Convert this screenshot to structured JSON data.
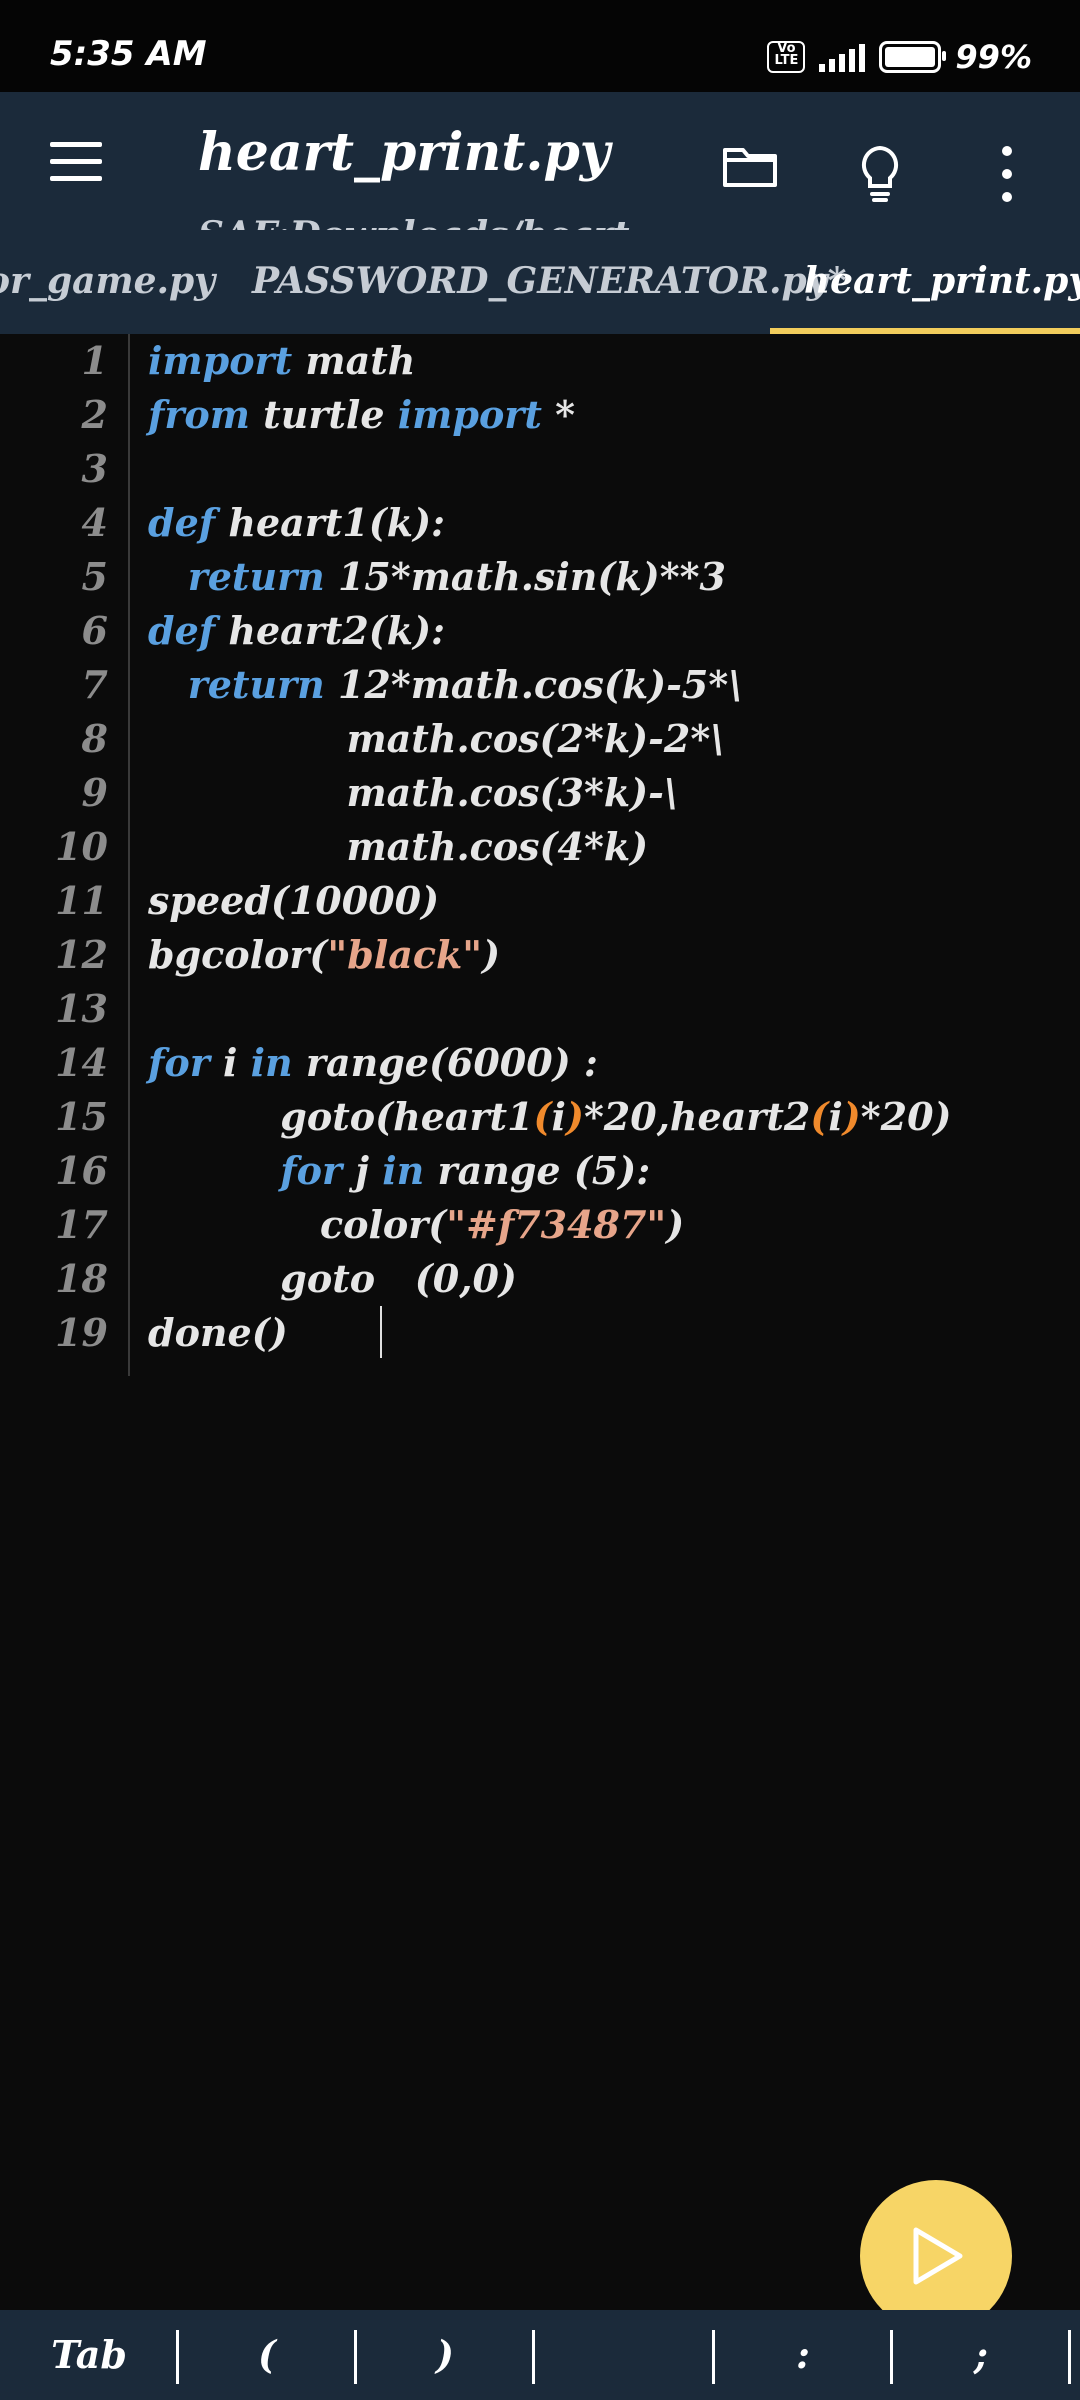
{
  "status_bar": {
    "time": "5:35 AM",
    "volte_label": "Vo LTE",
    "battery_percent": "99%",
    "battery_level": 0.99
  },
  "toolbar": {
    "title": "heart_print.py",
    "subtitle": "SAF:Downloads/heart"
  },
  "tabs": [
    {
      "label": "or_game.py"
    },
    {
      "label": "PASSWORD_GENERATOR.py*"
    },
    {
      "label": "heart_print.py"
    }
  ],
  "editor": {
    "lines": [
      {
        "n": "1",
        "segments": [
          {
            "t": "import",
            "c": "kw"
          },
          {
            "t": " math",
            "c": ""
          }
        ]
      },
      {
        "n": "2",
        "segments": [
          {
            "t": "from",
            "c": "kw"
          },
          {
            "t": " turtle ",
            "c": ""
          },
          {
            "t": "import",
            "c": "kw"
          },
          {
            "t": " *",
            "c": ""
          }
        ]
      },
      {
        "n": "3",
        "segments": []
      },
      {
        "n": "4",
        "segments": [
          {
            "t": "def",
            "c": "kw"
          },
          {
            "t": " heart1(k):",
            "c": ""
          }
        ]
      },
      {
        "n": "5",
        "segments": [
          {
            "t": "   ",
            "c": ""
          },
          {
            "t": "return",
            "c": "kw"
          },
          {
            "t": " 15*math.sin(k)**3",
            "c": ""
          }
        ]
      },
      {
        "n": "6",
        "segments": [
          {
            "t": "def",
            "c": "kw"
          },
          {
            "t": " heart2(k):",
            "c": ""
          }
        ]
      },
      {
        "n": "7",
        "segments": [
          {
            "t": "   ",
            "c": ""
          },
          {
            "t": "return",
            "c": "kw"
          },
          {
            "t": " 12*math.cos(k)-5*\\",
            "c": ""
          }
        ]
      },
      {
        "n": "8",
        "segments": [
          {
            "t": "               math.cos(2*k)-2*\\",
            "c": ""
          }
        ]
      },
      {
        "n": "9",
        "segments": [
          {
            "t": "               math.cos(3*k)-\\",
            "c": ""
          }
        ]
      },
      {
        "n": "10",
        "segments": [
          {
            "t": "               math.cos(4*k)",
            "c": ""
          }
        ]
      },
      {
        "n": "11",
        "segments": [
          {
            "t": "speed(10000)",
            "c": ""
          }
        ]
      },
      {
        "n": "12",
        "segments": [
          {
            "t": "bgcolor(",
            "c": ""
          },
          {
            "t": "\"black\"",
            "c": "str"
          },
          {
            "t": ")",
            "c": ""
          }
        ]
      },
      {
        "n": "13",
        "segments": []
      },
      {
        "n": "14",
        "segments": [
          {
            "t": "for",
            "c": "kw"
          },
          {
            "t": " i ",
            "c": ""
          },
          {
            "t": "in",
            "c": "kw"
          },
          {
            "t": " range(6000) :",
            "c": ""
          }
        ]
      },
      {
        "n": "15",
        "segments": [
          {
            "t": "          goto(heart1",
            "c": ""
          },
          {
            "t": "(",
            "c": "par"
          },
          {
            "t": "i",
            "c": ""
          },
          {
            "t": ")",
            "c": "par"
          },
          {
            "t": "*20,heart2",
            "c": ""
          },
          {
            "t": "(",
            "c": "par"
          },
          {
            "t": "i",
            "c": ""
          },
          {
            "t": ")",
            "c": "par"
          },
          {
            "t": "*20)",
            "c": ""
          }
        ]
      },
      {
        "n": "16",
        "segments": [
          {
            "t": "          ",
            "c": ""
          },
          {
            "t": "for",
            "c": "kw"
          },
          {
            "t": " j ",
            "c": ""
          },
          {
            "t": "in",
            "c": "kw"
          },
          {
            "t": " range (5):",
            "c": ""
          }
        ]
      },
      {
        "n": "17",
        "segments": [
          {
            "t": "             color(",
            "c": ""
          },
          {
            "t": "\"#f73487\"",
            "c": "str"
          },
          {
            "t": ")",
            "c": ""
          }
        ]
      },
      {
        "n": "18",
        "segments": [
          {
            "t": "          goto   (0,0)",
            "c": ""
          }
        ]
      },
      {
        "n": "19",
        "segments": [
          {
            "t": "done()",
            "c": ""
          }
        ]
      }
    ]
  },
  "fab": {
    "icon": "play-icon"
  },
  "keybar": {
    "keys": [
      "Tab",
      "(",
      ")",
      "",
      ":",
      ";"
    ]
  },
  "colors": {
    "toolbar_bg": "#1b2a3a",
    "editor_bg": "#0b0b0b",
    "keyword": "#5aa0e0",
    "string": "#e7a58a",
    "paren_highlight": "#f08a2c",
    "accent": "#f2cd5c",
    "fab": "#f7d566"
  }
}
